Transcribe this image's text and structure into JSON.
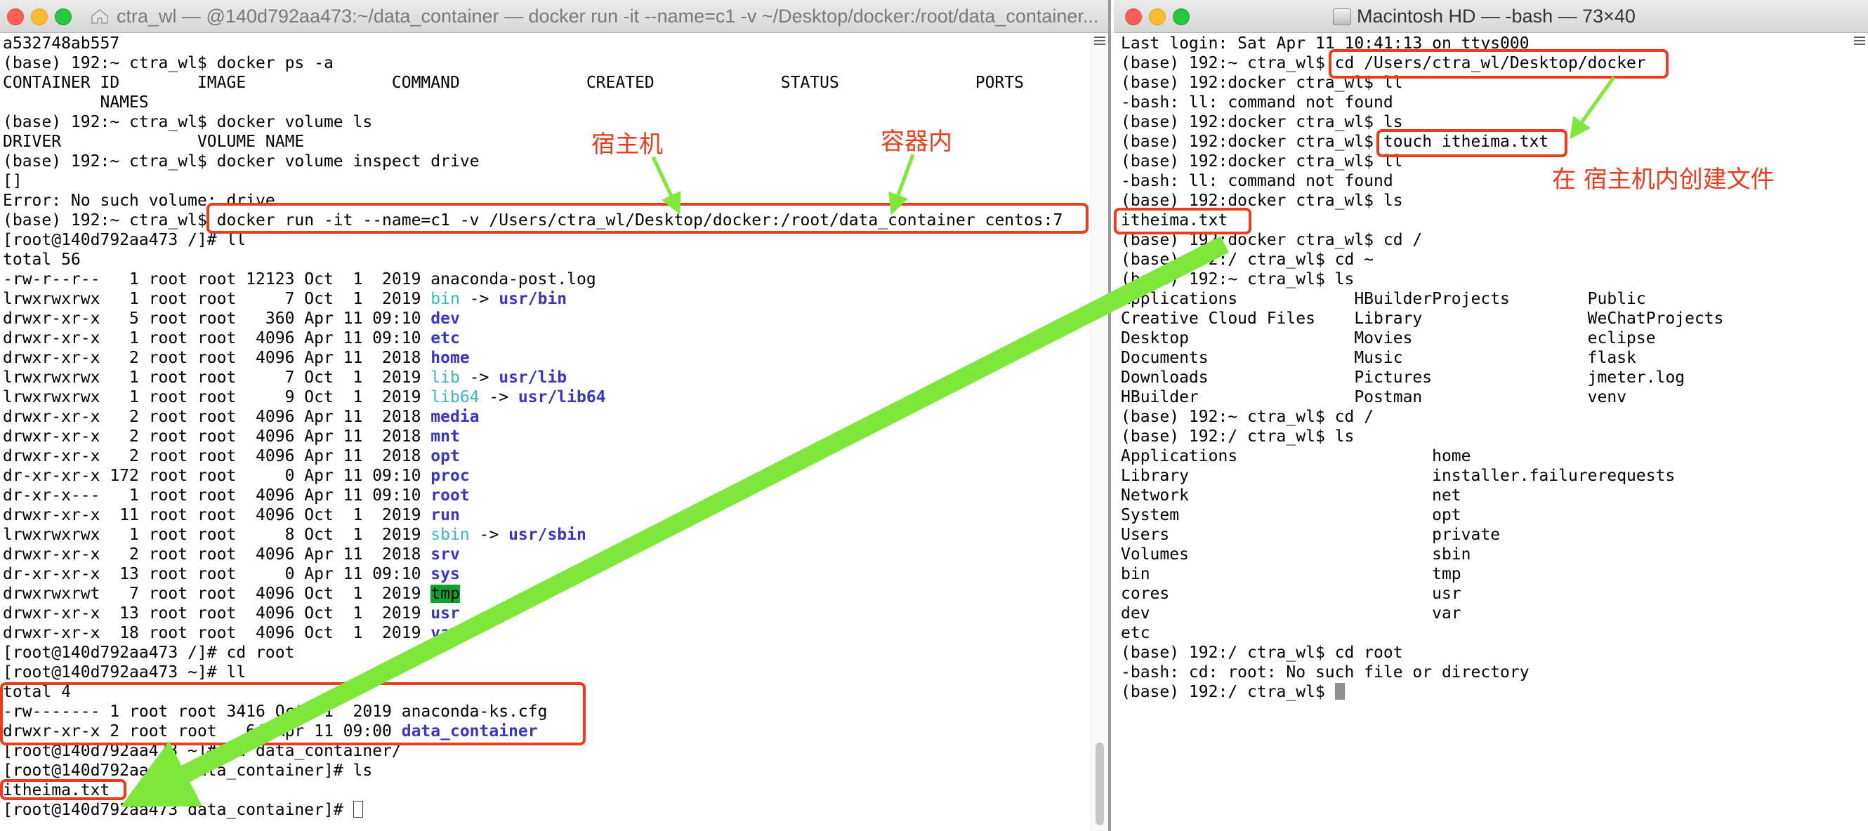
{
  "left_window": {
    "title": "ctra_wl — @140d792aa473:~/data_container — docker run -it --name=c1 -v ~/Desktop/docker:/root/data_container...",
    "lines": [
      [
        {
          "t": "a532748ab557"
        }
      ],
      [
        {
          "t": "(base) 192:~ ctra_wl$ docker ps -a"
        }
      ],
      [
        {
          "t": "CONTAINER ID        IMAGE               COMMAND             CREATED             STATUS              PORTS"
        }
      ],
      [
        {
          "t": "          NAMES"
        }
      ],
      [
        {
          "t": "(base) 192:~ ctra_wl$ docker volume ls"
        }
      ],
      [
        {
          "t": "DRIVER              VOLUME NAME"
        }
      ],
      [
        {
          "t": "(base) 192:~ ctra_wl$ docker volume inspect drive"
        }
      ],
      [
        {
          "t": "[]"
        }
      ],
      [
        {
          "t": "Error: No such volume: drive"
        }
      ],
      [
        {
          "t": "(base) 192:~ ctra_wl$ docker run -it --name=c1 -v /Users/ctra_wl/Desktop/docker:/root/data_container centos:7"
        }
      ],
      [
        {
          "t": "[root@140d792aa473 /]# ll"
        }
      ],
      [
        {
          "t": "total 56"
        }
      ],
      [
        {
          "t": "-rw-r--r--   1 root root 12123 Oct  1  2019 anaconda-post.log"
        }
      ],
      [
        {
          "t": "lrwxrwxrwx   1 root root     7 Oct  1  2019 "
        },
        {
          "t": "bin",
          "c": "link-cyan"
        },
        {
          "t": " -> "
        },
        {
          "t": "usr/bin",
          "c": "link-blue"
        }
      ],
      [
        {
          "t": "drwxr-xr-x   5 root root   360 Apr 11 09:10 "
        },
        {
          "t": "dev",
          "c": "dir-blue"
        }
      ],
      [
        {
          "t": "drwxr-xr-x   1 root root  4096 Apr 11 09:10 "
        },
        {
          "t": "etc",
          "c": "dir-blue"
        }
      ],
      [
        {
          "t": "drwxr-xr-x   2 root root  4096 Apr 11  2018 "
        },
        {
          "t": "home",
          "c": "dir-blue"
        }
      ],
      [
        {
          "t": "lrwxrwxrwx   1 root root     7 Oct  1  2019 "
        },
        {
          "t": "lib",
          "c": "link-cyan"
        },
        {
          "t": " -> "
        },
        {
          "t": "usr/lib",
          "c": "link-blue"
        }
      ],
      [
        {
          "t": "lrwxrwxrwx   1 root root     9 Oct  1  2019 "
        },
        {
          "t": "lib64",
          "c": "link-cyan"
        },
        {
          "t": " -> "
        },
        {
          "t": "usr/lib64",
          "c": "link-blue"
        }
      ],
      [
        {
          "t": "drwxr-xr-x   2 root root  4096 Apr 11  2018 "
        },
        {
          "t": "media",
          "c": "dir-blue"
        }
      ],
      [
        {
          "t": "drwxr-xr-x   2 root root  4096 Apr 11  2018 "
        },
        {
          "t": "mnt",
          "c": "dir-blue"
        }
      ],
      [
        {
          "t": "drwxr-xr-x   2 root root  4096 Apr 11  2018 "
        },
        {
          "t": "opt",
          "c": "dir-blue"
        }
      ],
      [
        {
          "t": "dr-xr-xr-x 172 root root     0 Apr 11 09:10 "
        },
        {
          "t": "proc",
          "c": "dir-blue"
        }
      ],
      [
        {
          "t": "dr-xr-x---   1 root root  4096 Apr 11 09:10 "
        },
        {
          "t": "root",
          "c": "dir-blue"
        }
      ],
      [
        {
          "t": "drwxr-xr-x  11 root root  4096 Oct  1  2019 "
        },
        {
          "t": "run",
          "c": "dir-blue"
        }
      ],
      [
        {
          "t": "lrwxrwxrwx   1 root root     8 Oct  1  2019 "
        },
        {
          "t": "sbin",
          "c": "link-cyan"
        },
        {
          "t": " -> "
        },
        {
          "t": "usr/sbin",
          "c": "link-blue"
        }
      ],
      [
        {
          "t": "drwxr-xr-x   2 root root  4096 Apr 11  2018 "
        },
        {
          "t": "srv",
          "c": "dir-blue"
        }
      ],
      [
        {
          "t": "dr-xr-xr-x  13 root root     0 Apr 11 09:10 "
        },
        {
          "t": "sys",
          "c": "dir-blue"
        }
      ],
      [
        {
          "t": "drwxrwxrwt   7 root root  4096 Oct  1  2019 "
        },
        {
          "t": "tmp",
          "c": "tmp-hl"
        }
      ],
      [
        {
          "t": "drwxr-xr-x  13 root root  4096 Oct  1  2019 "
        },
        {
          "t": "usr",
          "c": "dir-blue"
        }
      ],
      [
        {
          "t": "drwxr-xr-x  18 root root  4096 Oct  1  2019 "
        },
        {
          "t": "var",
          "c": "dir-blue"
        }
      ],
      [
        {
          "t": "[root@140d792aa473 /]# cd root"
        }
      ],
      [
        {
          "t": "[root@140d792aa473 ~]# ll"
        }
      ],
      [
        {
          "t": "total 4"
        }
      ],
      [
        {
          "t": "-rw------- 1 root root 3416 Oct  1  2019 anaconda-ks.cfg"
        }
      ],
      [
        {
          "t": "drwxr-xr-x 2 root root   64 Apr 11 09:00 "
        },
        {
          "t": "data_container",
          "c": "dir-blue"
        }
      ],
      [
        {
          "t": "[root@140d792aa473 ~]# cd data_container/"
        }
      ],
      [
        {
          "t": "[root@140d792aa473 data_container]# ls"
        }
      ],
      [
        {
          "t": "itheima.txt"
        }
      ],
      [
        {
          "t": "[root@140d792aa473 data_container]# "
        }
      ]
    ]
  },
  "right_window": {
    "title": "Macintosh HD — -bash — 73×40",
    "lines": [
      [
        {
          "t": "Last login: Sat Apr 11 10:41:13 on ttys000"
        }
      ],
      [
        {
          "t": "(base) 192:~ ctra_wl$ cd /Users/ctra_wl/Desktop/docker"
        }
      ],
      [
        {
          "t": "(base) 192:docker ctra_wl$ ll"
        }
      ],
      [
        {
          "t": "-bash: ll: command not found"
        }
      ],
      [
        {
          "t": "(base) 192:docker ctra_wl$ ls"
        }
      ],
      [
        {
          "t": "(base) 192:docker ctra_wl$ touch itheima.txt"
        }
      ],
      [
        {
          "t": "(base) 192:docker ctra_wl$ ll"
        }
      ],
      [
        {
          "t": "-bash: ll: command not found"
        }
      ],
      [
        {
          "t": "(base) 192:docker ctra_wl$ ls"
        }
      ],
      [
        {
          "t": "itheima.txt"
        }
      ],
      [
        {
          "t": "(base) 192:docker ctra_wl$ cd /"
        }
      ],
      [
        {
          "t": "(base) 192:/ ctra_wl$ cd ~"
        }
      ],
      [
        {
          "t": "(base) 192:~ ctra_wl$ ls"
        }
      ],
      [
        {
          "t": "Applications            HBuilderProjects        Public"
        }
      ],
      [
        {
          "t": "Creative Cloud Files    Library                 WeChatProjects"
        }
      ],
      [
        {
          "t": "Desktop                 Movies                  eclipse"
        }
      ],
      [
        {
          "t": "Documents               Music                   flask"
        }
      ],
      [
        {
          "t": "Downloads               Pictures                jmeter.log"
        }
      ],
      [
        {
          "t": "HBuilder                Postman                 venv"
        }
      ],
      [
        {
          "t": "(base) 192:~ ctra_wl$ cd /"
        }
      ],
      [
        {
          "t": "(base) 192:/ ctra_wl$ ls"
        }
      ],
      [
        {
          "t": "Applications                    home"
        }
      ],
      [
        {
          "t": "Library                         installer.failurerequests"
        }
      ],
      [
        {
          "t": "Network                         net"
        }
      ],
      [
        {
          "t": "System                          opt"
        }
      ],
      [
        {
          "t": "Users                           private"
        }
      ],
      [
        {
          "t": "Volumes                         sbin"
        }
      ],
      [
        {
          "t": "bin                             tmp"
        }
      ],
      [
        {
          "t": "cores                           usr"
        }
      ],
      [
        {
          "t": "dev                             var"
        }
      ],
      [
        {
          "t": "etc"
        }
      ],
      [
        {
          "t": "(base) 192:/ ctra_wl$ cd root"
        }
      ],
      [
        {
          "t": "-bash: cd: root: No such file or directory"
        }
      ],
      [
        {
          "t": "(base) 192:/ ctra_wl$ "
        }
      ]
    ]
  },
  "annotations": {
    "host_label": "宿主机",
    "container_label": "容器内",
    "create_file_label": "在 宿主机内创建文件"
  },
  "colors": {
    "annotation_red": "#ec3c1c",
    "arrow_green": "#7ee83a",
    "link_cyan": "#38b9c8",
    "dir_blue": "#3b34c9",
    "tmp_highlight": "#0ba42d"
  }
}
